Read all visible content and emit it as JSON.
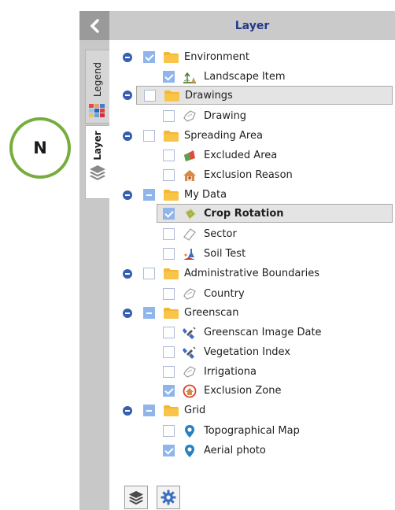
{
  "compass": {
    "label": "N"
  },
  "panel": {
    "title": "Layer",
    "tabs": [
      {
        "label": "Legend",
        "active": false
      },
      {
        "label": "Layer",
        "active": true
      }
    ]
  },
  "tree": [
    {
      "label": "Environment",
      "kind": "group",
      "state": "checked",
      "icon": "folder-icon"
    },
    {
      "label": "Landscape Item",
      "kind": "item",
      "state": "checked",
      "icon": "landscape-item-icon"
    },
    {
      "label": "Drawings",
      "kind": "group",
      "state": "unchecked",
      "icon": "folder-icon",
      "selected": true
    },
    {
      "label": "Drawing",
      "kind": "item",
      "state": "unchecked",
      "icon": "drawing-shape-icon"
    },
    {
      "label": "Spreading Area",
      "kind": "group",
      "state": "unchecked",
      "icon": "folder-icon"
    },
    {
      "label": "Excluded Area",
      "kind": "item",
      "state": "unchecked",
      "icon": "excluded-area-icon"
    },
    {
      "label": "Exclusion Reason",
      "kind": "item",
      "state": "unchecked",
      "icon": "exclusion-reason-icon"
    },
    {
      "label": "My Data",
      "kind": "group",
      "state": "partial",
      "icon": "folder-icon"
    },
    {
      "label": "Crop Rotation",
      "kind": "item",
      "state": "checked",
      "icon": "crop-rotation-icon",
      "selected": true,
      "bold": true
    },
    {
      "label": "Sector",
      "kind": "item",
      "state": "unchecked",
      "icon": "sector-icon"
    },
    {
      "label": "Soil Test",
      "kind": "item",
      "state": "unchecked",
      "icon": "soil-test-icon"
    },
    {
      "label": "Administrative Boundaries",
      "kind": "group",
      "state": "unchecked",
      "icon": "folder-icon"
    },
    {
      "label": "Country",
      "kind": "item",
      "state": "unchecked",
      "icon": "drawing-shape-icon"
    },
    {
      "label": "Greenscan",
      "kind": "group",
      "state": "partial",
      "icon": "folder-icon"
    },
    {
      "label": "Greenscan Image Date",
      "kind": "item",
      "state": "unchecked",
      "icon": "satellite-icon"
    },
    {
      "label": "Vegetation Index",
      "kind": "item",
      "state": "unchecked",
      "icon": "satellite-icon"
    },
    {
      "label": "Irrigationa",
      "kind": "item",
      "state": "unchecked",
      "icon": "drawing-shape-icon"
    },
    {
      "label": "Exclusion Zone",
      "kind": "item",
      "state": "checked",
      "icon": "exclusion-zone-icon"
    },
    {
      "label": "Grid",
      "kind": "group",
      "state": "partial",
      "icon": "folder-icon"
    },
    {
      "label": "Topographical Map",
      "kind": "item",
      "state": "unchecked",
      "icon": "map-pin-icon"
    },
    {
      "label": "Aerial photo",
      "kind": "item",
      "state": "checked",
      "icon": "map-pin-icon"
    }
  ],
  "footer": {
    "buttons": [
      {
        "name": "layers-button",
        "icon": "layers-icon"
      },
      {
        "name": "settings-button",
        "icon": "gear-icon"
      }
    ]
  },
  "colors": {
    "accent": "#365fb0",
    "header_title": "#24398a",
    "checkbox": "#8fb5ea",
    "folder": "#f5b731",
    "compass_ring": "#76ad3c"
  }
}
